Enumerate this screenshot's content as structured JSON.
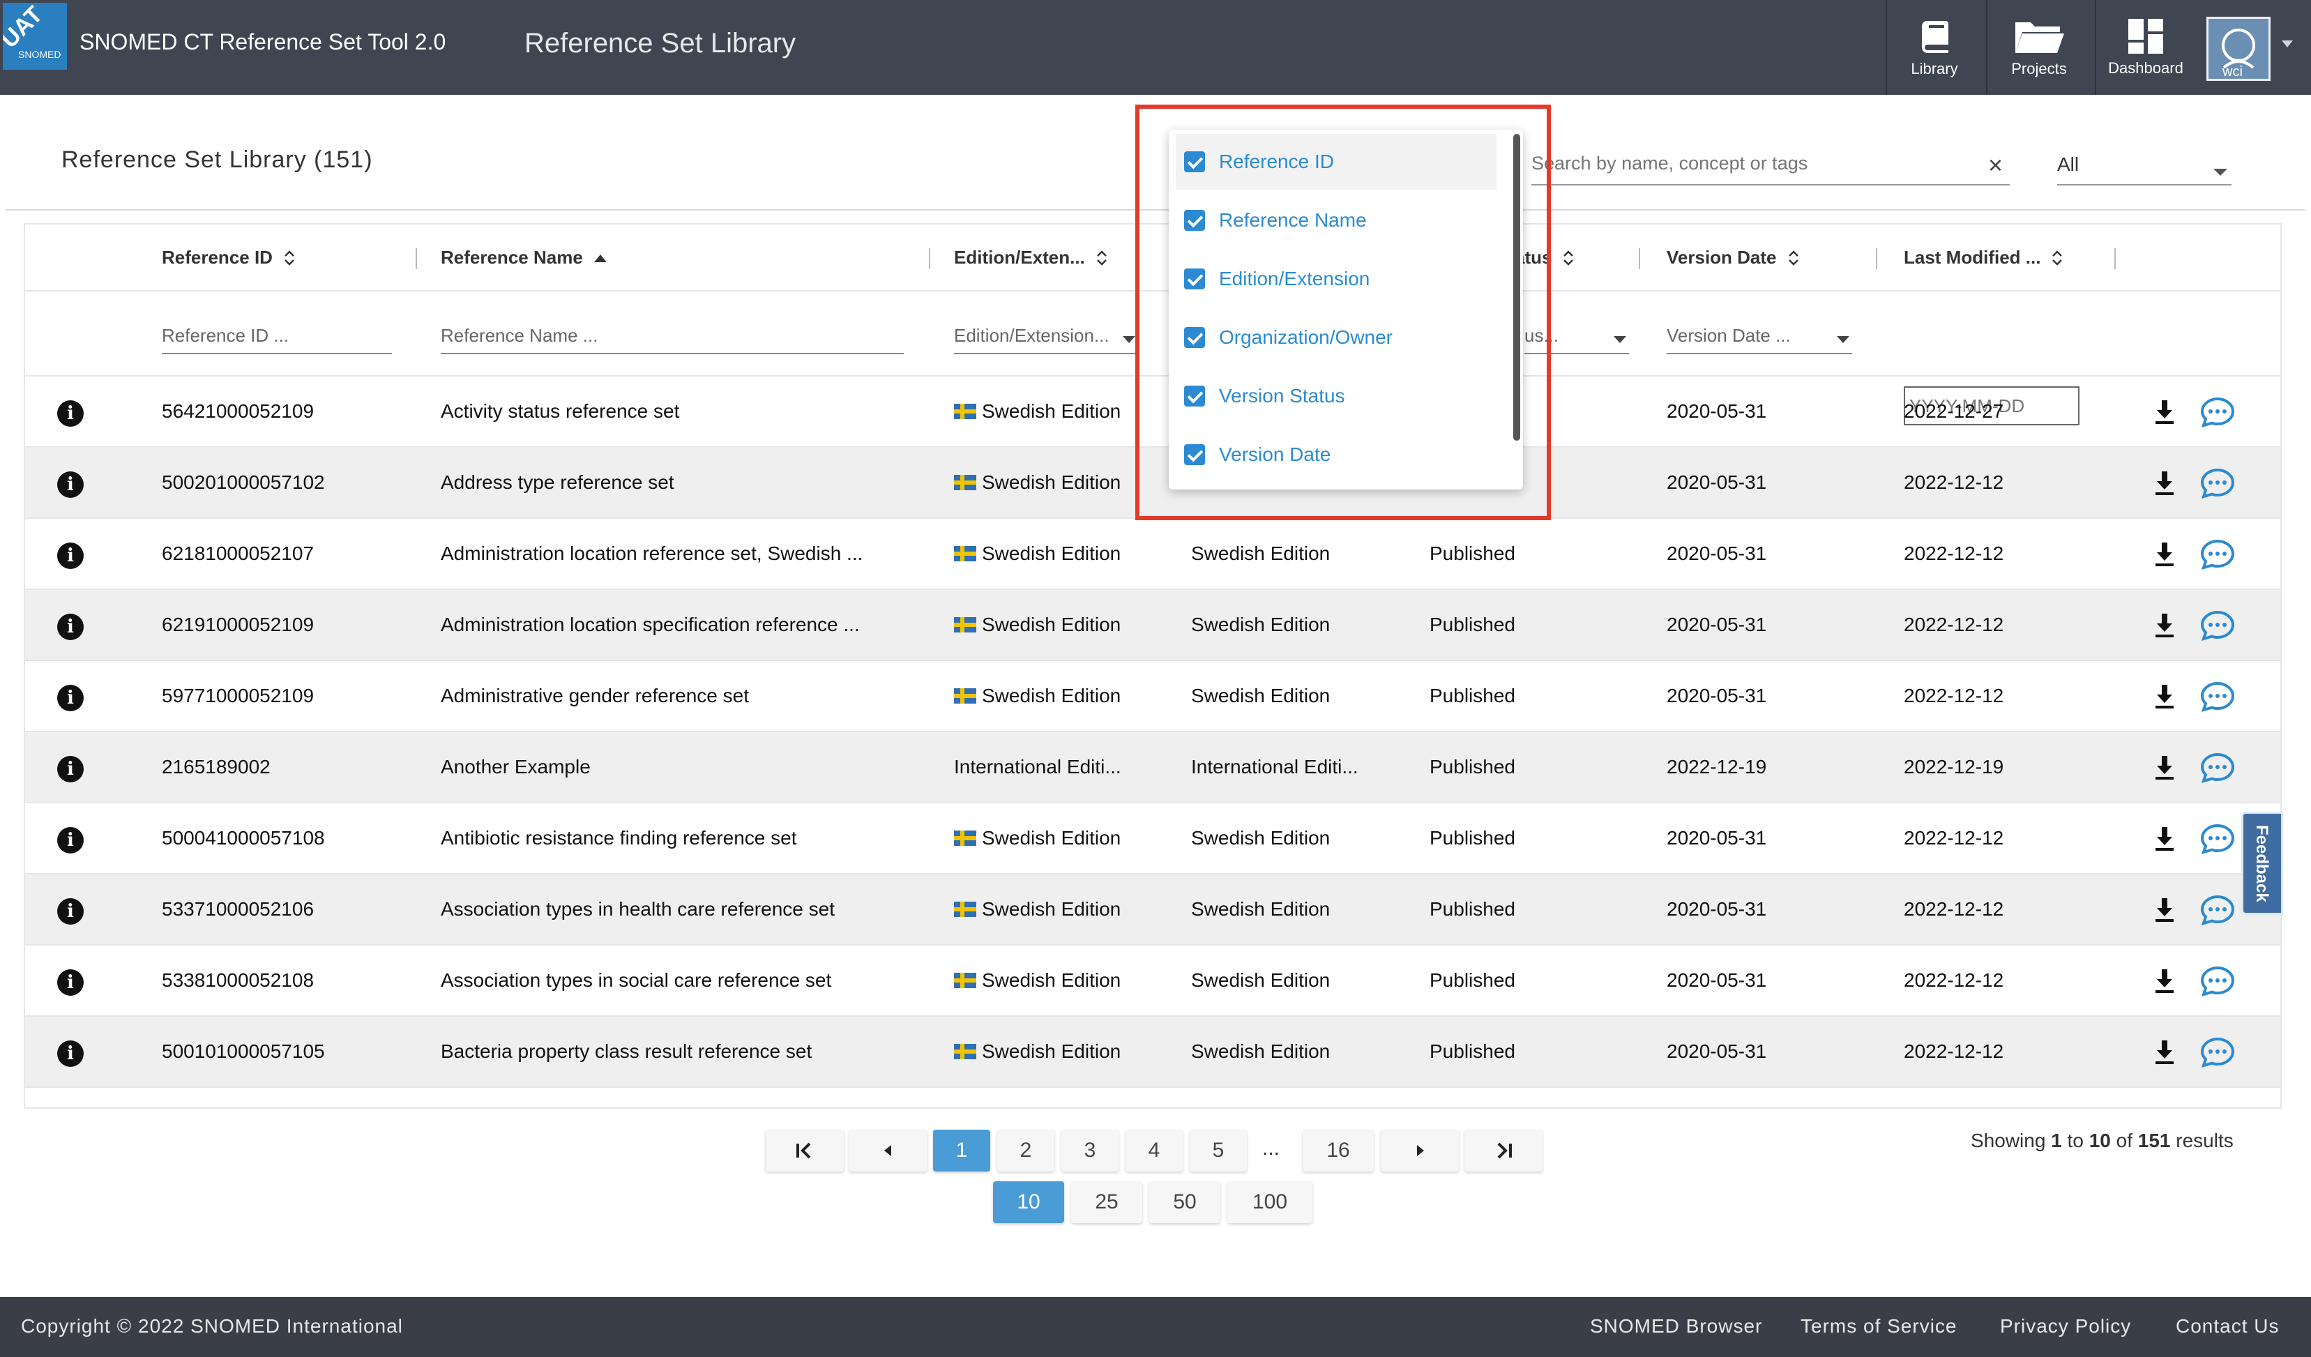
{
  "header": {
    "logo_badge": "UAT",
    "logo_text": "SNOMED",
    "app_title": "SNOMED CT Reference Set Tool 2.0",
    "page_heading": "Reference Set Library",
    "nav": [
      {
        "label": "Library",
        "icon": "book-icon"
      },
      {
        "label": "Projects",
        "icon": "folder-icon"
      },
      {
        "label": "Dashboard",
        "icon": "dashboard-icon"
      }
    ],
    "avatar_text": "wci"
  },
  "library": {
    "title": "Reference Set Library (151)",
    "search_placeholder": "Search by name, concept or tags",
    "filter_select": "All"
  },
  "table": {
    "columns": [
      "Reference ID",
      "Reference Name",
      "Edition/Exten...",
      "atus",
      "Version Date",
      "Last Modified ..."
    ],
    "filters": {
      "reference_id": "Reference ID ...",
      "reference_name": "Reference Name ...",
      "edition": "Edition/Extension...",
      "status": "us...",
      "version_date": "Version Date ...",
      "last_modified": "YYYY-MM-DD"
    },
    "rows": [
      {
        "id": "56421000052109",
        "name": "Activity status reference set",
        "edition": "Swedish Edition",
        "owner": "",
        "status": "",
        "version_date": "2020-05-31",
        "last_modified": "2022-12-27",
        "flag": true
      },
      {
        "id": "500201000057102",
        "name": "Address type reference set",
        "edition": "Swedish Edition",
        "owner": "",
        "status": "",
        "version_date": "2020-05-31",
        "last_modified": "2022-12-12",
        "flag": true
      },
      {
        "id": "62181000052107",
        "name": "Administration location reference set, Swedish ...",
        "edition": "Swedish Edition",
        "owner": "Swedish Edition",
        "status": "Published",
        "version_date": "2020-05-31",
        "last_modified": "2022-12-12",
        "flag": true
      },
      {
        "id": "62191000052109",
        "name": "Administration location specification reference ...",
        "edition": "Swedish Edition",
        "owner": "Swedish Edition",
        "status": "Published",
        "version_date": "2020-05-31",
        "last_modified": "2022-12-12",
        "flag": true
      },
      {
        "id": "59771000052109",
        "name": "Administrative gender reference set",
        "edition": "Swedish Edition",
        "owner": "Swedish Edition",
        "status": "Published",
        "version_date": "2020-05-31",
        "last_modified": "2022-12-12",
        "flag": true
      },
      {
        "id": "2165189002",
        "name": "Another Example",
        "edition": "International Editi...",
        "owner": "International Editi...",
        "status": "Published",
        "version_date": "2022-12-19",
        "last_modified": "2022-12-19",
        "flag": false
      },
      {
        "id": "500041000057108",
        "name": "Antibiotic resistance finding reference set",
        "edition": "Swedish Edition",
        "owner": "Swedish Edition",
        "status": "Published",
        "version_date": "2020-05-31",
        "last_modified": "2022-12-12",
        "flag": true
      },
      {
        "id": "53371000052106",
        "name": "Association types in health care reference set",
        "edition": "Swedish Edition",
        "owner": "Swedish Edition",
        "status": "Published",
        "version_date": "2020-05-31",
        "last_modified": "2022-12-12",
        "flag": true
      },
      {
        "id": "53381000052108",
        "name": "Association types in social care reference set",
        "edition": "Swedish Edition",
        "owner": "Swedish Edition",
        "status": "Published",
        "version_date": "2020-05-31",
        "last_modified": "2022-12-12",
        "flag": true
      },
      {
        "id": "500101000057105",
        "name": "Bacteria property class result reference set",
        "edition": "Swedish Edition",
        "owner": "Swedish Edition",
        "status": "Published",
        "version_date": "2020-05-31",
        "last_modified": "2022-12-12",
        "flag": true
      }
    ]
  },
  "column_chooser": {
    "options": [
      "Reference ID",
      "Reference Name",
      "Edition/Extension",
      "Organization/Owner",
      "Version Status",
      "Version Date"
    ]
  },
  "pagination": {
    "pages": [
      "1",
      "2",
      "3",
      "4",
      "5"
    ],
    "ellipsis": "...",
    "last_page": "16",
    "current_page": "1",
    "page_sizes": [
      "10",
      "25",
      "50",
      "100"
    ],
    "current_size": "10",
    "showing_prefix": "Showing",
    "showing_from": "1",
    "showing_to_word": "to",
    "showing_to": "10",
    "showing_of_word": "of",
    "showing_total": "151",
    "showing_suffix": "results"
  },
  "feedback_label": "Feedback",
  "footer": {
    "copyright": "Copyright © 2022 SNOMED International",
    "links": [
      "SNOMED Browser",
      "Terms of Service",
      "Privacy Policy",
      "Contact Us"
    ]
  },
  "colors": {
    "header_bg": "#3f4652",
    "accent": "#4a9cd6",
    "highlight_box": "#e43a2a",
    "footer_bg": "#3a3f47"
  }
}
